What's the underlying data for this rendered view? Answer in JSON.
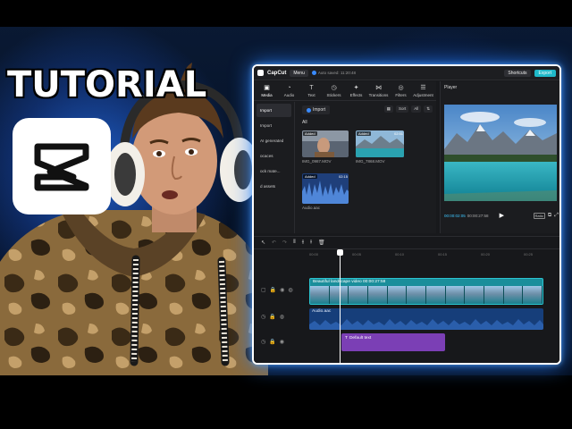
{
  "thumbnail": {
    "headline": "TUTORIAL"
  },
  "app": {
    "name": "CapCut",
    "menu_label": "Menu",
    "autosave_text": "Auto saved: 11:20:48",
    "shortcuts_label": "Shortcuts",
    "export_label": "Export",
    "tools": [
      {
        "label": "Media",
        "icon": "media-icon"
      },
      {
        "label": "Audio",
        "icon": "audio-icon"
      },
      {
        "label": "Text",
        "icon": "text-icon"
      },
      {
        "label": "Stickers",
        "icon": "stickers-icon"
      },
      {
        "label": "Effects",
        "icon": "effects-icon"
      },
      {
        "label": "Transitions",
        "icon": "transitions-icon"
      },
      {
        "label": "Filters",
        "icon": "filters-icon"
      },
      {
        "label": "Adjustment",
        "icon": "adjustment-icon"
      }
    ],
    "sidebar": [
      "Import",
      "Import",
      "AI generated",
      "ocaces",
      "ock mate...",
      "d assets"
    ],
    "media": {
      "import_label": "Import",
      "sort_label": "Sort",
      "all_filter": "All",
      "all_heading": "All",
      "clips": [
        {
          "name": "IMG_0987.MOV",
          "badge": "Added",
          "duration": ""
        },
        {
          "name": "IMG_7868.MOV",
          "badge": "Added",
          "duration": "02:51"
        },
        {
          "name": "Audio.aac",
          "badge": "Added",
          "duration": "02:15"
        }
      ]
    },
    "player": {
      "title": "Player",
      "current_time": "00:00:02:05",
      "total_time": "00:00:27:58",
      "ratio_label": "Ratio"
    },
    "timeline": {
      "ticks": [
        "00:00",
        "00:05",
        "00:10",
        "00:15",
        "00:20",
        "00:25"
      ],
      "video_clip_label": "Beautiful landscape video  00:00:27:58",
      "audio_clip_label": "Audio.aac",
      "text_clip_label": "Default text"
    }
  },
  "colors": {
    "accent": "#1fb9c9",
    "video_track": "#1a8e9b",
    "audio_track": "#163e7a",
    "text_track": "#7b3fb5",
    "glow": "#2878ff"
  }
}
